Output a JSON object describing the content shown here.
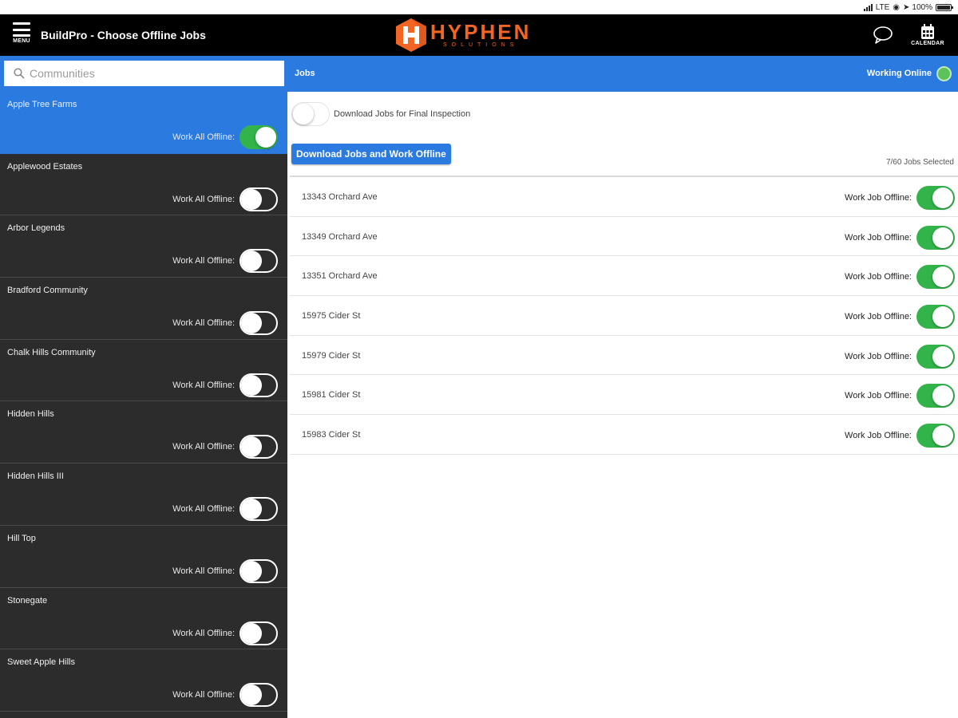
{
  "status_bar": {
    "network": "LTE",
    "battery": "100%"
  },
  "header": {
    "menu_label": "MENU",
    "title": "BuildPro - Choose Offline Jobs",
    "logo_text": "HYPHEN",
    "logo_subtext": "SOLUTIONS",
    "calendar_label": "CALENDAR"
  },
  "sidebar": {
    "search_placeholder": "Communities",
    "offline_label": "Work All Offline:",
    "communities": [
      {
        "name": "Apple Tree Farms",
        "offline": true,
        "selected": true
      },
      {
        "name": "Applewood Estates",
        "offline": false
      },
      {
        "name": "Arbor Legends",
        "offline": false
      },
      {
        "name": "Bradford Community",
        "offline": false
      },
      {
        "name": "Chalk Hills Community",
        "offline": false
      },
      {
        "name": "Hidden Hills",
        "offline": false
      },
      {
        "name": "Hidden Hills III",
        "offline": false
      },
      {
        "name": "Hill Top",
        "offline": false
      },
      {
        "name": "Stonegate",
        "offline": false
      },
      {
        "name": "Sweet Apple Hills",
        "offline": false
      }
    ]
  },
  "main": {
    "section_label": "Jobs",
    "connection_status": "Working Online",
    "final_inspection_label": "Download Jobs for Final Inspection",
    "final_inspection_on": false,
    "download_button_label": "Download Jobs and Work Offline",
    "jobs_selected": "7/60 Jobs Selected",
    "job_offline_label": "Work Job Offline:",
    "jobs": [
      {
        "address": "13343 Orchard Ave",
        "offline": true
      },
      {
        "address": "13349 Orchard Ave",
        "offline": true
      },
      {
        "address": "13351 Orchard Ave",
        "offline": true
      },
      {
        "address": "15975 Cider St",
        "offline": true
      },
      {
        "address": "15979 Cider St",
        "offline": true
      },
      {
        "address": "15981 Cider St",
        "offline": true
      },
      {
        "address": "15983 Cider St",
        "offline": true
      }
    ]
  },
  "colors": {
    "accent_blue": "#2a7ae0",
    "toggle_on": "#32b44a",
    "sidebar_bg": "#2c2c2c",
    "brand_orange": "#f26522",
    "header_bg": "#000000"
  }
}
